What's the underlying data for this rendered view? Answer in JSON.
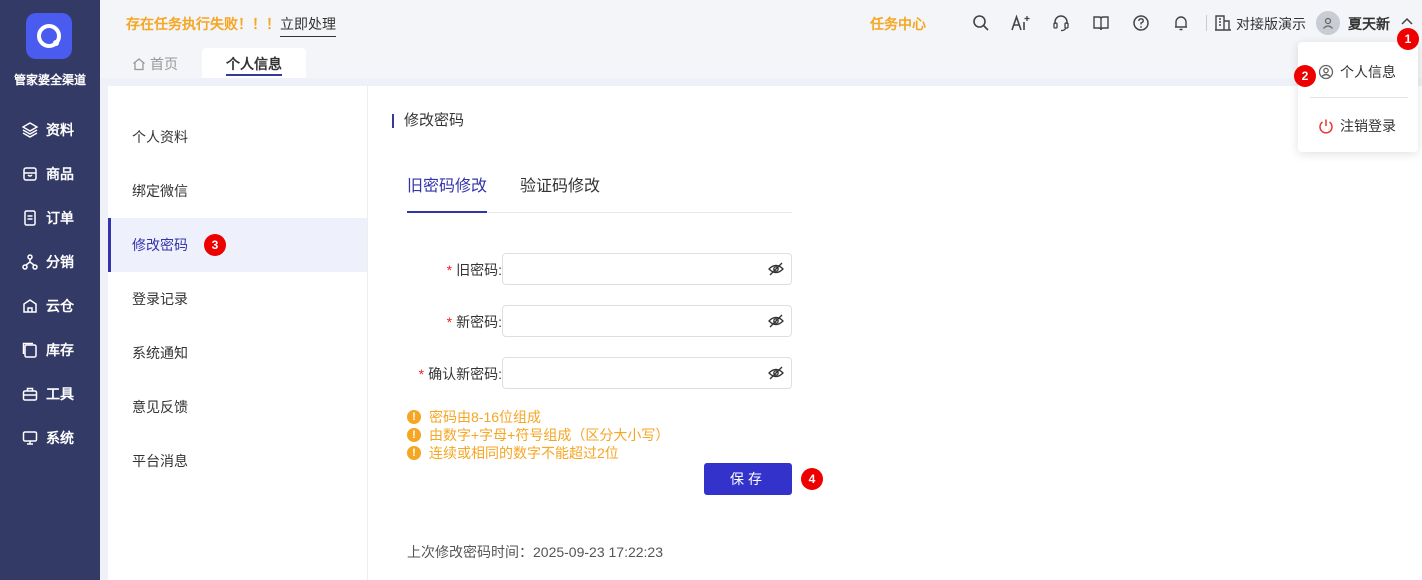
{
  "sidebar": {
    "brand": "管家婆全渠道",
    "items": [
      {
        "label": "资料",
        "icon": "layers-icon"
      },
      {
        "label": "商品",
        "icon": "box-icon"
      },
      {
        "label": "订单",
        "icon": "document-icon"
      },
      {
        "label": "分销",
        "icon": "network-icon"
      },
      {
        "label": "云仓",
        "icon": "cloud-warehouse-icon"
      },
      {
        "label": "库存",
        "icon": "inventory-icon"
      },
      {
        "label": "工具",
        "icon": "toolbox-icon"
      },
      {
        "label": "系统",
        "icon": "monitor-icon"
      }
    ]
  },
  "header": {
    "alert_text": "存在任务执行失败！！！",
    "alert_link": "立即处理",
    "task_center": "任务中心",
    "company": "对接版演示",
    "username": "夏天新"
  },
  "tabs": {
    "home": "首页",
    "active": "个人信息"
  },
  "subnav": {
    "items": [
      "个人资料",
      "绑定微信",
      "修改密码",
      "登录记录",
      "系统通知",
      "意见反馈",
      "平台消息"
    ]
  },
  "main": {
    "section_title": "修改密码",
    "tab_old": "旧密码修改",
    "tab_code": "验证码修改",
    "fields": {
      "old_label": "旧密码",
      "new_label": "新密码",
      "confirm_label": "确认新密码",
      "colon": ":"
    },
    "hints": [
      "密码由8-16位组成",
      "由数字+字母+符号组成（区分大小写）",
      "连续或相同的数字不能超过2位"
    ],
    "save_label": "保存",
    "last_change": "上次修改密码时间：2025-09-23 17:22:23"
  },
  "dropdown": {
    "profile": "个人信息",
    "logout": "注销登录"
  },
  "badges": [
    "1",
    "2",
    "3",
    "4"
  ],
  "colors": {
    "sidebar_bg": "#343a66",
    "accent": "#3333cc",
    "warning": "#f5a623",
    "badge": "#e00000"
  }
}
